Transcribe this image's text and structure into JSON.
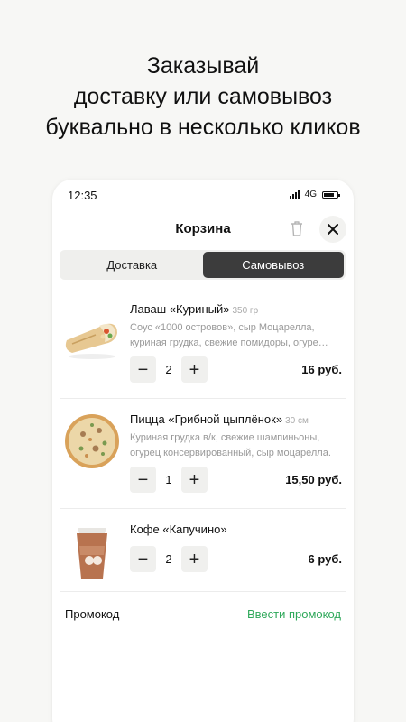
{
  "headline": {
    "line1": "Заказывай",
    "line2": "доставку или самовывоз",
    "line3": "буквально в несколько кликов"
  },
  "status": {
    "time": "12:35",
    "network": "4G"
  },
  "cart": {
    "title": "Корзина",
    "tabs": [
      {
        "label": "Доставка",
        "active": false
      },
      {
        "label": "Самовывоз",
        "active": true
      }
    ],
    "items": [
      {
        "name": "Лаваш «Куриный»",
        "size": "350 гр",
        "desc_line1": "Соус «1000 островов», сыр Моцарелла,",
        "desc_line2": "куриная грудка, свежие помидоры, огуре…",
        "quantity": "2",
        "price": "16 руб."
      },
      {
        "name": "Пицца «Грибной цыплёнок»",
        "size": "30 см",
        "desc_line1": "Куриная грудка в/к, свежие шампиньоны,",
        "desc_line2": "огурец консервированный, сыр моцарелла.",
        "quantity": "1",
        "price": "15,50 руб."
      },
      {
        "name": "Кофе «Капучино»",
        "quantity": "2",
        "price": "6 руб."
      }
    ],
    "minus": "−",
    "plus": "+",
    "promo_label": "Промокод",
    "promo_link": "Ввести промокод"
  },
  "colors": {
    "accent_green": "#2ea85a",
    "active_tab": "#3c3c3c"
  },
  "icons": [
    "signal-icon",
    "battery-icon",
    "trash-icon",
    "close-icon",
    "lavash-image",
    "pizza-image",
    "coffee-cup-image"
  ]
}
